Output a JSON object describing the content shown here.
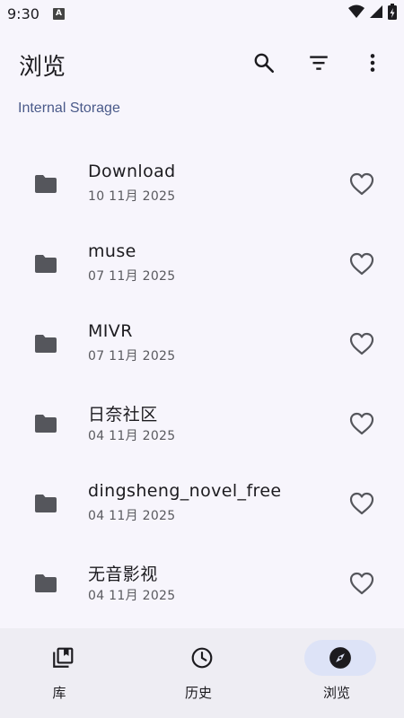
{
  "status_bar": {
    "time": "9:30",
    "notification_glyph": "A",
    "icons": [
      "wifi-icon",
      "signal-icon",
      "battery-charging-icon"
    ]
  },
  "header": {
    "title": "浏览",
    "actions": [
      "search-icon",
      "filter-icon",
      "more-vert-icon"
    ]
  },
  "breadcrumb": "Internal Storage",
  "files": [
    {
      "name": "Download",
      "date": "10 11月 2025"
    },
    {
      "name": "muse",
      "date": "07 11月 2025"
    },
    {
      "name": "MIVR",
      "date": "07 11月 2025"
    },
    {
      "name": "日奈社区",
      "date": "04 11月 2025"
    },
    {
      "name": "dingsheng_novel_free",
      "date": "04 11月 2025"
    },
    {
      "name": "无音影视",
      "date": "04 11月 2025"
    }
  ],
  "bottom_nav": [
    {
      "label": "库",
      "icon": "library-icon",
      "active": false
    },
    {
      "label": "历史",
      "icon": "history-icon",
      "active": false
    },
    {
      "label": "浏览",
      "icon": "explore-icon",
      "active": true
    }
  ],
  "colors": {
    "background": "#f7f5fc",
    "accent_text": "#4a5a8a",
    "nav_background": "#eeedf3",
    "active_pill": "#dde3f7",
    "icon": "#55565c"
  }
}
